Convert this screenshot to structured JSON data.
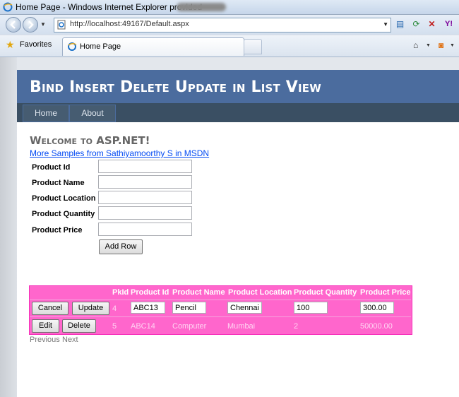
{
  "window": {
    "title": "Home Page - Windows Internet Explorer provided"
  },
  "address": {
    "url": "http://localhost:49167/Default.aspx"
  },
  "favorites": {
    "label": "Favorites"
  },
  "tab": {
    "label": "Home Page"
  },
  "site": {
    "title": "Bind Insert Delete Update in List View"
  },
  "menu": {
    "items": [
      {
        "label": "Home"
      },
      {
        "label": "About"
      }
    ]
  },
  "main": {
    "welcome": "Welcome to ASP.NET!",
    "link": "More Samples from Sathiyamoorthy S in MSDN"
  },
  "form": {
    "fields": [
      {
        "label": "Product Id",
        "value": ""
      },
      {
        "label": "Product Name",
        "value": ""
      },
      {
        "label": "Product Location",
        "value": ""
      },
      {
        "label": "Product Quantity",
        "value": ""
      },
      {
        "label": "Product Price",
        "value": ""
      }
    ],
    "add_button": "Add Row"
  },
  "listview": {
    "headers": [
      "PkId",
      "Product Id",
      "Product Name",
      "Product Location",
      "Product Quantity",
      "Product Price"
    ],
    "rows": [
      {
        "actions": [
          "Cancel",
          "Update"
        ],
        "pkid": "4",
        "product_id": "ABC13",
        "product_name": "Pencil",
        "product_location": "Chennai",
        "product_quantity": "100",
        "product_price": "300.00"
      },
      {
        "actions": [
          "Edit",
          "Delete"
        ],
        "pkid": "5",
        "product_id": "ABC14",
        "product_name": "Computer",
        "product_location": "Mumbai",
        "product_quantity": "2",
        "product_price": "50000.00"
      }
    ],
    "pager": {
      "previous": "Previous",
      "next": "Next"
    }
  },
  "colors": {
    "header_bg": "#4b6c9e",
    "menu_bg": "#3a4f63",
    "listview_bg": "#ff66cc",
    "link": "#034af3"
  }
}
